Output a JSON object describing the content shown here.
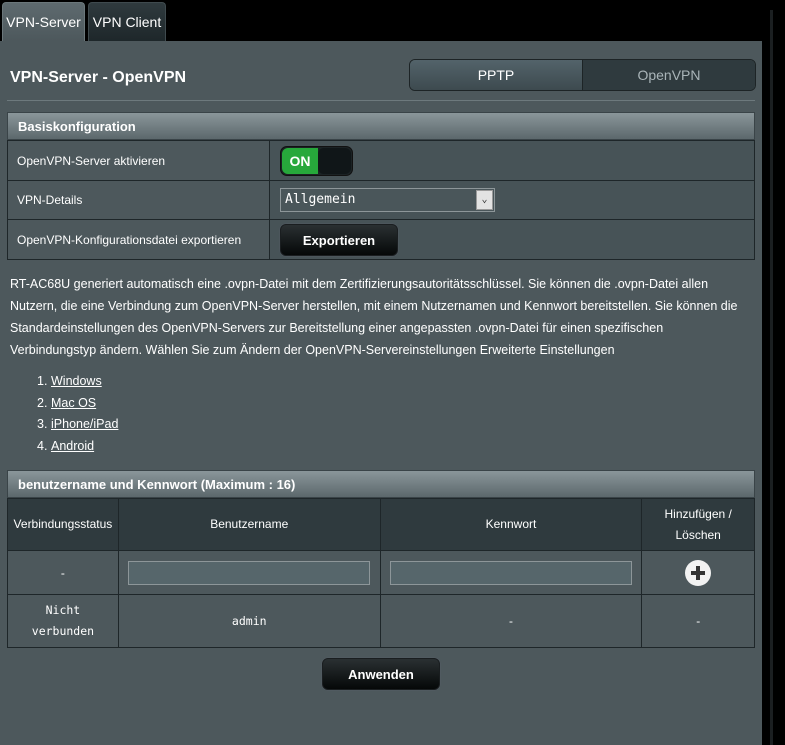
{
  "tabs": [
    {
      "label": "VPN-Server",
      "active": true
    },
    {
      "label": "VPN Client",
      "active": false
    }
  ],
  "page_title": "VPN-Server - OpenVPN",
  "mode_switch": {
    "options": [
      "PPTP",
      "OpenVPN"
    ],
    "selected": "OpenVPN"
  },
  "basic": {
    "header": "Basiskonfiguration",
    "enable_label": "OpenVPN-Server aktivieren",
    "enable_state": "ON",
    "details_label": "VPN-Details",
    "details_value": "Allgemein",
    "export_label": "OpenVPN-Konfigurationsdatei exportieren",
    "export_button": "Exportieren"
  },
  "description": "RT-AC68U generiert automatisch eine .ovpn-Datei mit dem Zertifizierungsautoritätsschlüssel. Sie können die .ovpn-Datei allen Nutzern, die eine Verbindung zum OpenVPN-Server herstellen, mit einem Nutzernamen und Kennwort bereitstellen. Sie können die Standardeinstellungen des OpenVPN-Servers zur Bereitstellung einer angepassten .ovpn-Datei für einen spezifischen Verbindungstyp ändern. Wählen Sie zum Ändern der OpenVPN-Servereinstellungen Erweiterte Einstellungen",
  "links": [
    {
      "num": "1.",
      "label": "Windows"
    },
    {
      "num": "2.",
      "label": "Mac OS"
    },
    {
      "num": "3.",
      "label": "iPhone/iPad"
    },
    {
      "num": "4.",
      "label": "Android"
    }
  ],
  "users": {
    "header": "benutzername und Kennwort (Maximum : 16)",
    "columns": [
      "Verbindungsstatus",
      "Benutzername",
      "Kennwort",
      "Hinzufügen / Löschen"
    ],
    "input_row": {
      "status": "-",
      "username": "",
      "password": ""
    },
    "rows": [
      {
        "status": "Nicht verbunden",
        "username": "admin",
        "password": "-",
        "action": "-"
      }
    ]
  },
  "apply_button": "Anwenden"
}
